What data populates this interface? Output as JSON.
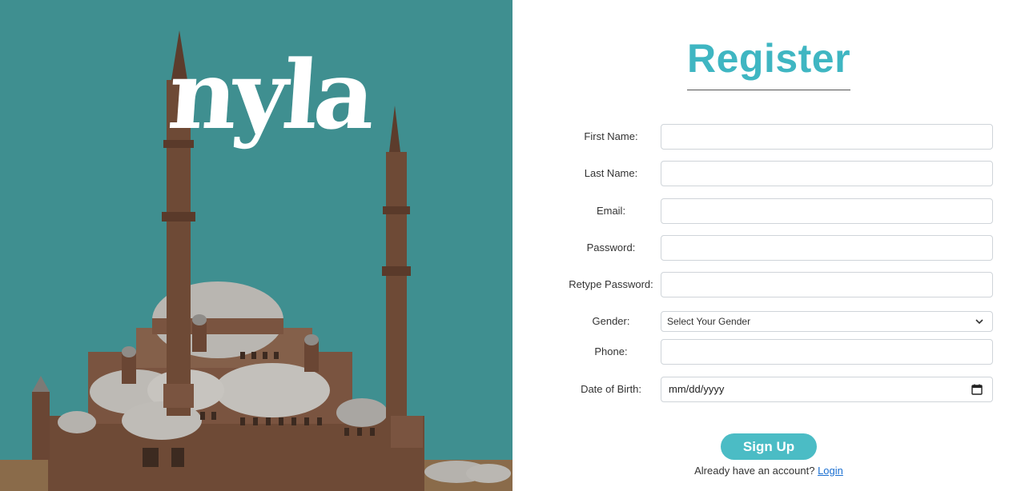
{
  "brand": {
    "logo_text": "nyla"
  },
  "colors": {
    "hero_bg": "#3f8f90",
    "accent": "#4bbcc5",
    "title": "#3fb6c2",
    "link": "#1a6fd1"
  },
  "form": {
    "title": "Register",
    "fields": [
      {
        "label": "First Name:",
        "value": ""
      },
      {
        "label": "Last Name:",
        "value": ""
      },
      {
        "label": "Email:",
        "value": ""
      },
      {
        "label": "Password:",
        "value": ""
      },
      {
        "label": "Retype Password:",
        "value": ""
      },
      {
        "label": "Gender:",
        "selected": "Select Your Gender"
      },
      {
        "label": "Phone:",
        "value": ""
      },
      {
        "label": "Date of Birth:",
        "placeholder": "mm/dd/yyyy"
      }
    ],
    "submit_label": "Sign Up",
    "login_prompt": "Already have an account?",
    "login_link": "Login"
  },
  "icons": {
    "select_arrow": "chevron-down-icon",
    "date_picker": "calendar-icon"
  }
}
